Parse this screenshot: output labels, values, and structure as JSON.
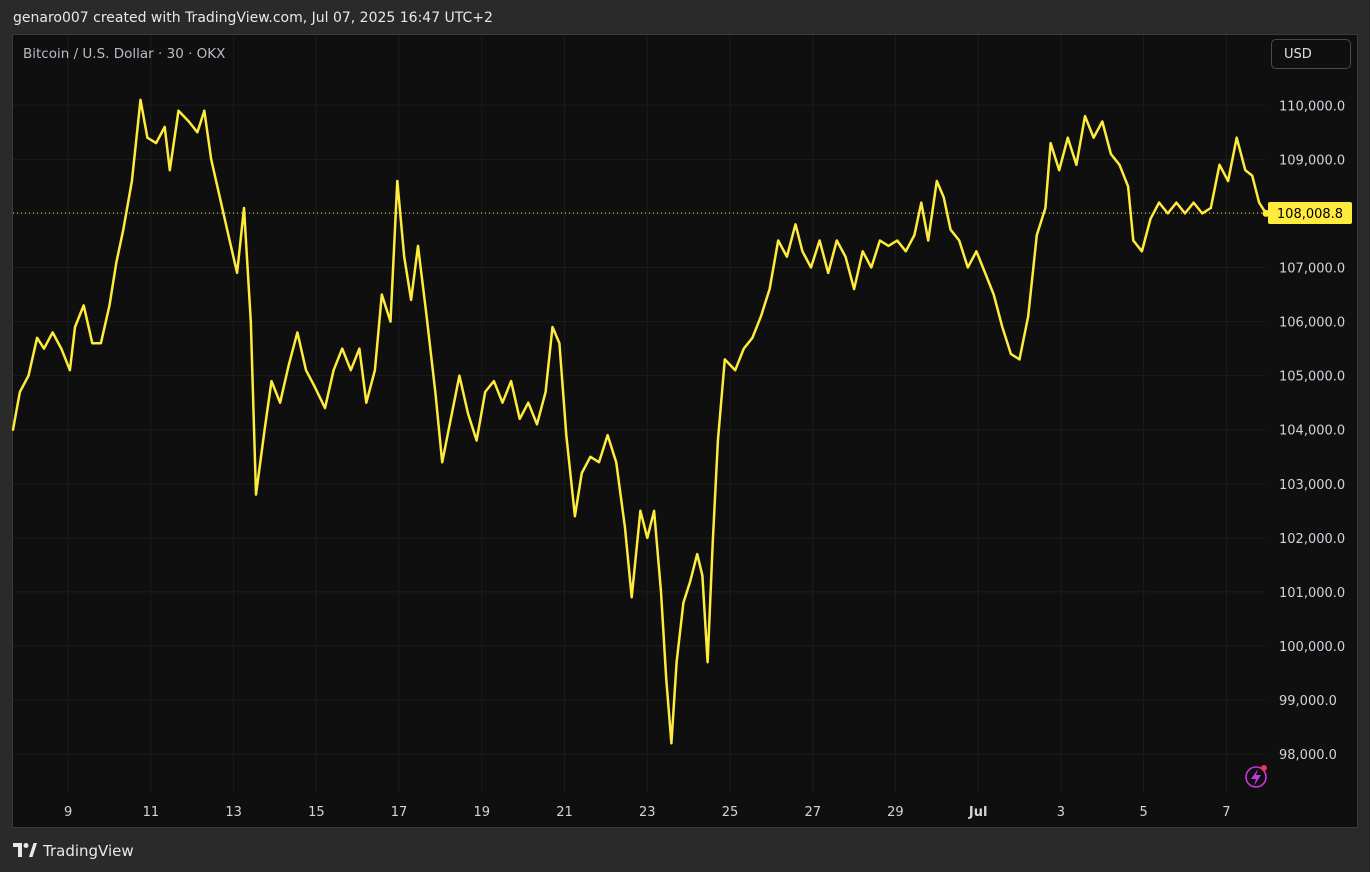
{
  "header": {
    "caption": "genaro007 created with TradingView.com, Jul 07, 2025 16:47 UTC+2"
  },
  "symbol": {
    "title": "Bitcoin / U.S. Dollar · 30 · OKX"
  },
  "currency_button": "USD",
  "footer": {
    "brand": "TradingView"
  },
  "colors": {
    "line": "#ffeb3b",
    "background": "#0f0f0f",
    "grid": "#1c1c1c",
    "axis_text": "#d1d4dc",
    "last_price_bg": "#ffeb3b",
    "bolt_icon": "#c23adb"
  },
  "icons": [
    "tradingview-logo-icon",
    "bolt-alert-icon"
  ],
  "chart_data": {
    "type": "line",
    "title": "Bitcoin / U.S. Dollar · 30 · OKX",
    "xlabel": "",
    "ylabel": "",
    "ylim": [
      97300,
      111300
    ],
    "y_ticks": [
      98000,
      99000,
      100000,
      101000,
      102000,
      103000,
      104000,
      105000,
      106000,
      107000,
      108000,
      109000,
      110000
    ],
    "y_tick_labels": [
      "98,000.0",
      "99,000.0",
      "100,000.0",
      "101,000.0",
      "102,000.0",
      "103,000.0",
      "104,000.0",
      "105,000.0",
      "106,000.0",
      "107,000.0",
      "108,000.0",
      "109,000.0",
      "110,000.0"
    ],
    "x_range": [
      "2025-06-07T16:00",
      "2025-07-07T23:00"
    ],
    "x_ticks": [
      "2025-06-09",
      "2025-06-11",
      "2025-06-13",
      "2025-06-15",
      "2025-06-17",
      "2025-06-19",
      "2025-06-21",
      "2025-06-23",
      "2025-06-25",
      "2025-06-27",
      "2025-06-29",
      "2025-07-01",
      "2025-07-03",
      "2025-07-05",
      "2025-07-07"
    ],
    "x_tick_labels": [
      "9",
      "11",
      "13",
      "15",
      "17",
      "19",
      "21",
      "23",
      "25",
      "27",
      "29",
      "Jul",
      "3",
      "5",
      "7"
    ],
    "grid": true,
    "last_price": 108008.8,
    "last_price_label": "108,008.8",
    "series": [
      {
        "points": [
          [
            "2025-06-07T16:00",
            104000
          ],
          [
            "2025-06-07T20:00",
            104700
          ],
          [
            "2025-06-08T01:00",
            105000
          ],
          [
            "2025-06-08T06:00",
            105700
          ],
          [
            "2025-06-08T10:00",
            105500
          ],
          [
            "2025-06-08T15:00",
            105800
          ],
          [
            "2025-06-08T20:00",
            105500
          ],
          [
            "2025-06-09T01:00",
            105100
          ],
          [
            "2025-06-09T04:00",
            105900
          ],
          [
            "2025-06-09T09:00",
            106300
          ],
          [
            "2025-06-09T14:00",
            105600
          ],
          [
            "2025-06-09T19:00",
            105600
          ],
          [
            "2025-06-10T00:00",
            106300
          ],
          [
            "2025-06-10T04:00",
            107100
          ],
          [
            "2025-06-10T08:00",
            107700
          ],
          [
            "2025-06-10T13:00",
            108600
          ],
          [
            "2025-06-10T18:00",
            110100
          ],
          [
            "2025-06-10T22:00",
            109400
          ],
          [
            "2025-06-11T03:00",
            109300
          ],
          [
            "2025-06-11T08:00",
            109600
          ],
          [
            "2025-06-11T11:00",
            108800
          ],
          [
            "2025-06-11T16:00",
            109900
          ],
          [
            "2025-06-11T22:00",
            109700
          ],
          [
            "2025-06-12T03:00",
            109500
          ],
          [
            "2025-06-12T07:00",
            109900
          ],
          [
            "2025-06-12T11:00",
            109000
          ],
          [
            "2025-06-12T16:00",
            108300
          ],
          [
            "2025-06-12T21:00",
            107600
          ],
          [
            "2025-06-13T02:00",
            106900
          ],
          [
            "2025-06-13T06:00",
            108100
          ],
          [
            "2025-06-13T10:00",
            106000
          ],
          [
            "2025-06-13T13:00",
            102800
          ],
          [
            "2025-06-13T18:00",
            104000
          ],
          [
            "2025-06-13T22:00",
            104900
          ],
          [
            "2025-06-14T03:00",
            104500
          ],
          [
            "2025-06-14T08:00",
            105200
          ],
          [
            "2025-06-14T13:00",
            105800
          ],
          [
            "2025-06-14T18:00",
            105100
          ],
          [
            "2025-06-14T23:00",
            104800
          ],
          [
            "2025-06-15T05:00",
            104400
          ],
          [
            "2025-06-15T10:00",
            105100
          ],
          [
            "2025-06-15T15:00",
            105500
          ],
          [
            "2025-06-15T20:00",
            105100
          ],
          [
            "2025-06-16T01:00",
            105500
          ],
          [
            "2025-06-16T05:00",
            104500
          ],
          [
            "2025-06-16T10:00",
            105100
          ],
          [
            "2025-06-16T14:00",
            106500
          ],
          [
            "2025-06-16T19:00",
            106000
          ],
          [
            "2025-06-16T23:00",
            108600
          ],
          [
            "2025-06-17T03:00",
            107200
          ],
          [
            "2025-06-17T07:00",
            106400
          ],
          [
            "2025-06-17T11:00",
            107400
          ],
          [
            "2025-06-17T16:00",
            106100
          ],
          [
            "2025-06-17T21:00",
            104700
          ],
          [
            "2025-06-18T01:00",
            103400
          ],
          [
            "2025-06-18T06:00",
            104200
          ],
          [
            "2025-06-18T11:00",
            105000
          ],
          [
            "2025-06-18T16:00",
            104300
          ],
          [
            "2025-06-18T21:00",
            103800
          ],
          [
            "2025-06-19T02:00",
            104700
          ],
          [
            "2025-06-19T07:00",
            104900
          ],
          [
            "2025-06-19T12:00",
            104500
          ],
          [
            "2025-06-19T17:00",
            104900
          ],
          [
            "2025-06-19T22:00",
            104200
          ],
          [
            "2025-06-20T03:00",
            104500
          ],
          [
            "2025-06-20T08:00",
            104100
          ],
          [
            "2025-06-20T13:00",
            104700
          ],
          [
            "2025-06-20T17:00",
            105900
          ],
          [
            "2025-06-20T21:00",
            105600
          ],
          [
            "2025-06-21T01:00",
            103900
          ],
          [
            "2025-06-21T06:00",
            102400
          ],
          [
            "2025-06-21T10:00",
            103200
          ],
          [
            "2025-06-21T15:00",
            103500
          ],
          [
            "2025-06-21T20:00",
            103400
          ],
          [
            "2025-06-22T01:00",
            103900
          ],
          [
            "2025-06-22T06:00",
            103400
          ],
          [
            "2025-06-22T11:00",
            102200
          ],
          [
            "2025-06-22T15:00",
            100900
          ],
          [
            "2025-06-22T20:00",
            102500
          ],
          [
            "2025-06-23T00:00",
            102000
          ],
          [
            "2025-06-23T04:00",
            102500
          ],
          [
            "2025-06-23T08:00",
            101000
          ],
          [
            "2025-06-23T11:00",
            99400
          ],
          [
            "2025-06-23T14:00",
            98200
          ],
          [
            "2025-06-23T17:00",
            99700
          ],
          [
            "2025-06-23T21:00",
            100800
          ],
          [
            "2025-06-24T01:00",
            101200
          ],
          [
            "2025-06-24T05:00",
            101700
          ],
          [
            "2025-06-24T08:00",
            101300
          ],
          [
            "2025-06-24T11:00",
            99700
          ],
          [
            "2025-06-24T14:00",
            101900
          ],
          [
            "2025-06-24T17:00",
            103800
          ],
          [
            "2025-06-24T21:00",
            105300
          ],
          [
            "2025-06-25T03:00",
            105100
          ],
          [
            "2025-06-25T08:00",
            105500
          ],
          [
            "2025-06-25T13:00",
            105700
          ],
          [
            "2025-06-25T18:00",
            106100
          ],
          [
            "2025-06-25T23:00",
            106600
          ],
          [
            "2025-06-26T04:00",
            107500
          ],
          [
            "2025-06-26T09:00",
            107200
          ],
          [
            "2025-06-26T14:00",
            107800
          ],
          [
            "2025-06-26T18:00",
            107300
          ],
          [
            "2025-06-26T23:00",
            107000
          ],
          [
            "2025-06-27T04:00",
            107500
          ],
          [
            "2025-06-27T09:00",
            106900
          ],
          [
            "2025-06-27T14:00",
            107500
          ],
          [
            "2025-06-27T19:00",
            107200
          ],
          [
            "2025-06-28T00:00",
            106600
          ],
          [
            "2025-06-28T05:00",
            107300
          ],
          [
            "2025-06-28T10:00",
            107000
          ],
          [
            "2025-06-28T15:00",
            107500
          ],
          [
            "2025-06-28T20:00",
            107400
          ],
          [
            "2025-06-29T01:00",
            107500
          ],
          [
            "2025-06-29T06:00",
            107300
          ],
          [
            "2025-06-29T11:00",
            107600
          ],
          [
            "2025-06-29T15:00",
            108200
          ],
          [
            "2025-06-29T19:00",
            107500
          ],
          [
            "2025-06-30T00:00",
            108600
          ],
          [
            "2025-06-30T04:00",
            108300
          ],
          [
            "2025-06-30T08:00",
            107700
          ],
          [
            "2025-06-30T13:00",
            107500
          ],
          [
            "2025-06-30T18:00",
            107000
          ],
          [
            "2025-06-30T23:00",
            107300
          ],
          [
            "2025-07-01T04:00",
            106900
          ],
          [
            "2025-07-01T09:00",
            106500
          ],
          [
            "2025-07-01T14:00",
            105900
          ],
          [
            "2025-07-01T19:00",
            105400
          ],
          [
            "2025-07-02T00:00",
            105300
          ],
          [
            "2025-07-02T05:00",
            106100
          ],
          [
            "2025-07-02T10:00",
            107600
          ],
          [
            "2025-07-02T15:00",
            108100
          ],
          [
            "2025-07-02T18:00",
            109300
          ],
          [
            "2025-07-02T23:00",
            108800
          ],
          [
            "2025-07-03T04:00",
            109400
          ],
          [
            "2025-07-03T09:00",
            108900
          ],
          [
            "2025-07-03T14:00",
            109800
          ],
          [
            "2025-07-03T19:00",
            109400
          ],
          [
            "2025-07-04T00:00",
            109700
          ],
          [
            "2025-07-04T05:00",
            109100
          ],
          [
            "2025-07-04T10:00",
            108900
          ],
          [
            "2025-07-04T15:00",
            108500
          ],
          [
            "2025-07-04T18:00",
            107500
          ],
          [
            "2025-07-04T23:00",
            107300
          ],
          [
            "2025-07-05T04:00",
            107900
          ],
          [
            "2025-07-05T09:00",
            108200
          ],
          [
            "2025-07-05T14:00",
            108000
          ],
          [
            "2025-07-05T19:00",
            108200
          ],
          [
            "2025-07-06T00:00",
            108000
          ],
          [
            "2025-07-06T05:00",
            108200
          ],
          [
            "2025-07-06T10:00",
            108000
          ],
          [
            "2025-07-06T15:00",
            108100
          ],
          [
            "2025-07-06T20:00",
            108900
          ],
          [
            "2025-07-07T01:00",
            108600
          ],
          [
            "2025-07-07T06:00",
            109400
          ],
          [
            "2025-07-07T11:00",
            108800
          ],
          [
            "2025-07-07T15:00",
            108700
          ],
          [
            "2025-07-07T19:00",
            108200
          ],
          [
            "2025-07-07T23:00",
            108000
          ]
        ]
      }
    ]
  }
}
